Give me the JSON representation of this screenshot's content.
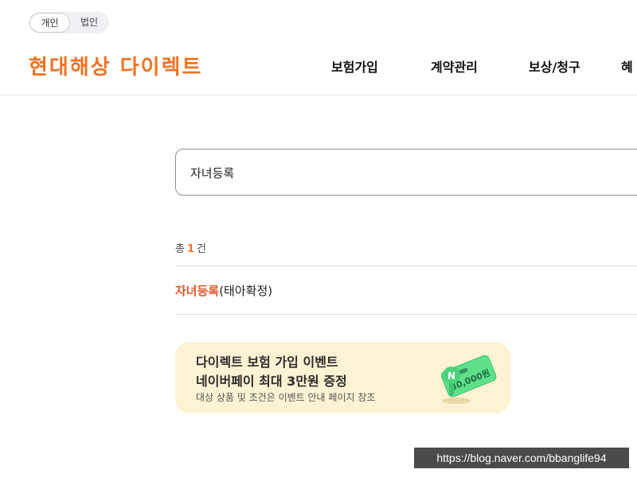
{
  "customer_type": {
    "options": [
      "개인",
      "법인"
    ],
    "selected": "개인"
  },
  "logo_text": "현대해상 다이렉트",
  "nav": {
    "items": [
      "보험가입",
      "계약관리",
      "보상/청구",
      "혜"
    ]
  },
  "search": {
    "value": "자녀등록"
  },
  "results": {
    "count_prefix": "총",
    "count": "1",
    "count_suffix": "건",
    "items": [
      {
        "highlight": "자녀등록",
        "rest": "(태아확정)"
      }
    ]
  },
  "banner": {
    "title": "다이렉트 보험 가입 이벤트",
    "subtitle": "네이버페이 최대 3만원 증정",
    "note": "대상 상품 및 조건은 이벤트 안내 페이지 참조",
    "coupon_text": "30,000원",
    "coupon_letter": "N"
  },
  "watermark": "https://blog.naver.com/bbanglife94",
  "colors": {
    "brand_orange": "#f37321",
    "highlight": "#e2582a",
    "banner_bg": "#fdf2d3",
    "coupon_green": "#5ee08b"
  }
}
